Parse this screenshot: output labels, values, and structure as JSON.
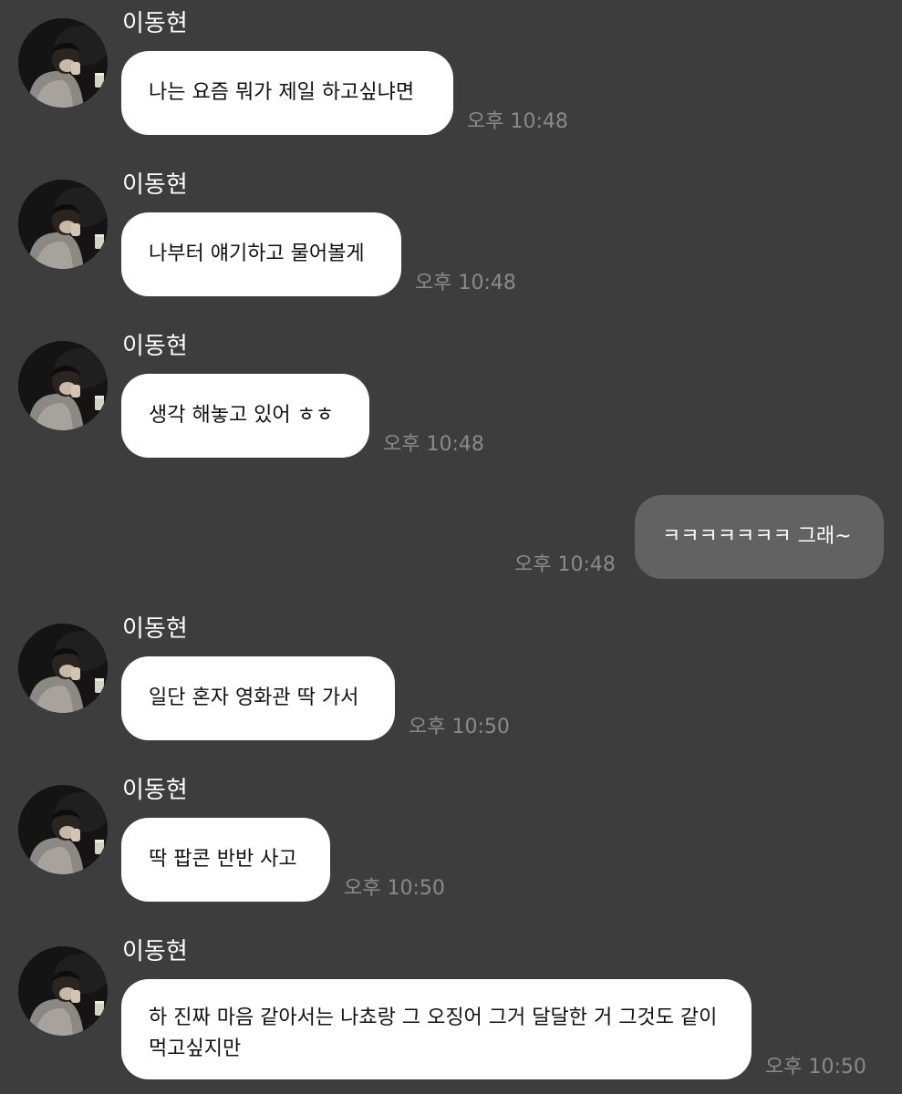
{
  "messages": [
    {
      "sender": "이동현",
      "text": "나는 요즘 뭐가 제일 하고싶냐면",
      "time": "오후 10:48"
    },
    {
      "sender": "이동현",
      "text": "나부터 얘기하고 물어볼게",
      "time": "오후 10:48"
    },
    {
      "sender": "이동현",
      "text": "생각 해놓고 있어 ㅎㅎ",
      "time": "오후 10:48"
    },
    {
      "text": "ㅋㅋㅋㅋㅋㅋㅋ 그래~",
      "time": "오후 10:48"
    },
    {
      "sender": "이동현",
      "text": "일단 혼자 영화관 딱 가서",
      "time": "오후 10:50"
    },
    {
      "sender": "이동현",
      "text": "딱 팝콘 반반 사고",
      "time": "오후 10:50"
    },
    {
      "sender": "이동현",
      "text": "하 진짜 마음 같아서는 나쵸랑 그 오징어 그거 달달한 거 그것도 같이 먹고싶지만",
      "time": "오후 10:50"
    }
  ]
}
